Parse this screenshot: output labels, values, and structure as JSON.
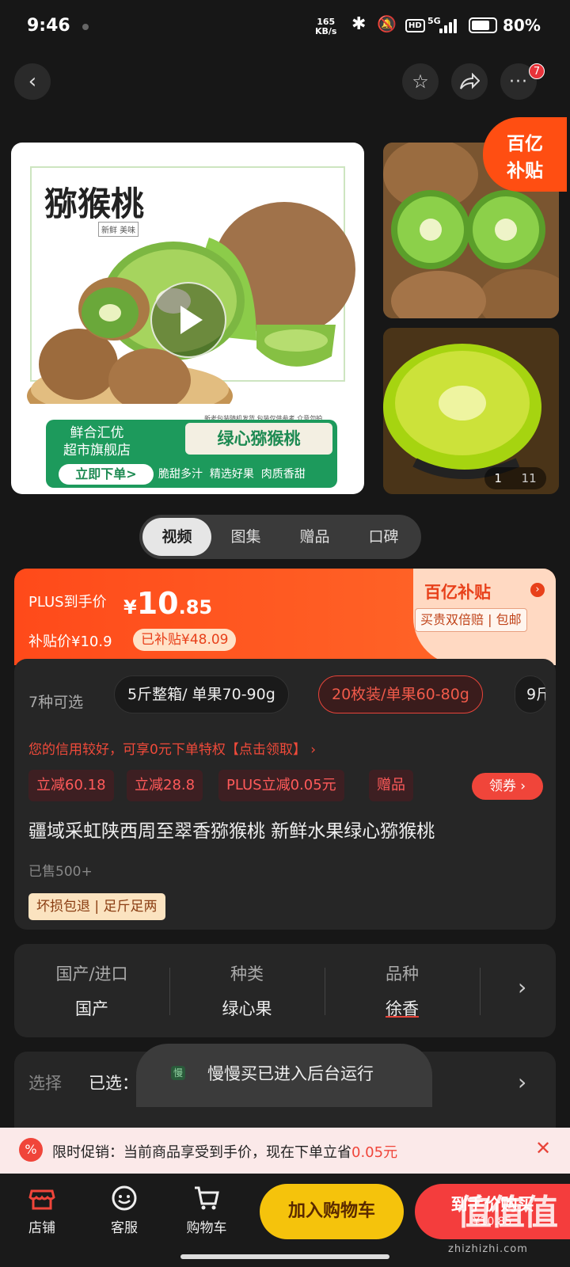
{
  "status_bar": {
    "time": "9:46",
    "net_speed_value": "165",
    "net_speed_unit": "KB/s",
    "network": "5G",
    "battery": "80%",
    "battery_level": 0.8
  },
  "nav": {
    "cart_badge": "7"
  },
  "gallery": {
    "main_title": "猕猴桃",
    "main_small": "新鲜 美味",
    "main_fineprint": "新老包装随机发货 包装仅供参考 介意勿拍",
    "store_line1": "鲜合汇优",
    "store_line2": "超市旗舰店",
    "order_now": "立即下单>",
    "variety_banner": "绿心猕猴桃",
    "features": "脆甜多汁  精选好果  肉质香甜",
    "subsidy_tag_top": "百亿",
    "subsidy_tag_bottom": "补贴",
    "index_current": "1",
    "index_total": "11"
  },
  "tabs": [
    "视频",
    "图集",
    "赠品",
    "口碑"
  ],
  "price": {
    "plus_label": "PLUS到手价",
    "currency": "¥",
    "int": "10",
    "dec": ".85",
    "subsidy_price": "补贴价¥10.9",
    "subsidized": "已补贴¥48.09",
    "brand_tag": "百亿补贴",
    "guarantee": "买贵双倍赔 | 包邮"
  },
  "options": {
    "count": "7种可选",
    "chips": [
      "5斤整箱/ 单果70-90g",
      "20枚装/单果60-80g",
      "9斤"
    ]
  },
  "credit": "您的信用较好，可享0元下单特权【点击领取】 ›",
  "promos": [
    "立减60.18",
    "立减28.8",
    "PLUS立减0.05元",
    "赠品"
  ],
  "coupon": "领券 ›",
  "title": "疆域采虹陕西周至翠香猕猴桃 新鲜水果绿心猕猴桃",
  "sold": "已售500+",
  "service_tags": "坏损包退 | 足斤足两",
  "attributes": [
    {
      "key": "国产/进口",
      "value": "国产"
    },
    {
      "key": "种类",
      "value": "绿心果"
    },
    {
      "key": "品种",
      "value": "徐香"
    }
  ],
  "select": {
    "label": "选择",
    "selected": "已选："
  },
  "toast": "慢慢买已进入后台运行",
  "limited": {
    "text": "限时促销：当前商品享受到手价，现在下单立省",
    "amount": "0.05元"
  },
  "bottom_nav": [
    {
      "label": "店铺"
    },
    {
      "label": "客服"
    },
    {
      "label": "购物车"
    }
  ],
  "buttons": {
    "add_cart": "加入购物车",
    "buy": "到手价购买",
    "buy_sub": "¥10.85"
  },
  "watermark": {
    "logo": "值",
    "site": "zhizhizhi.com"
  }
}
